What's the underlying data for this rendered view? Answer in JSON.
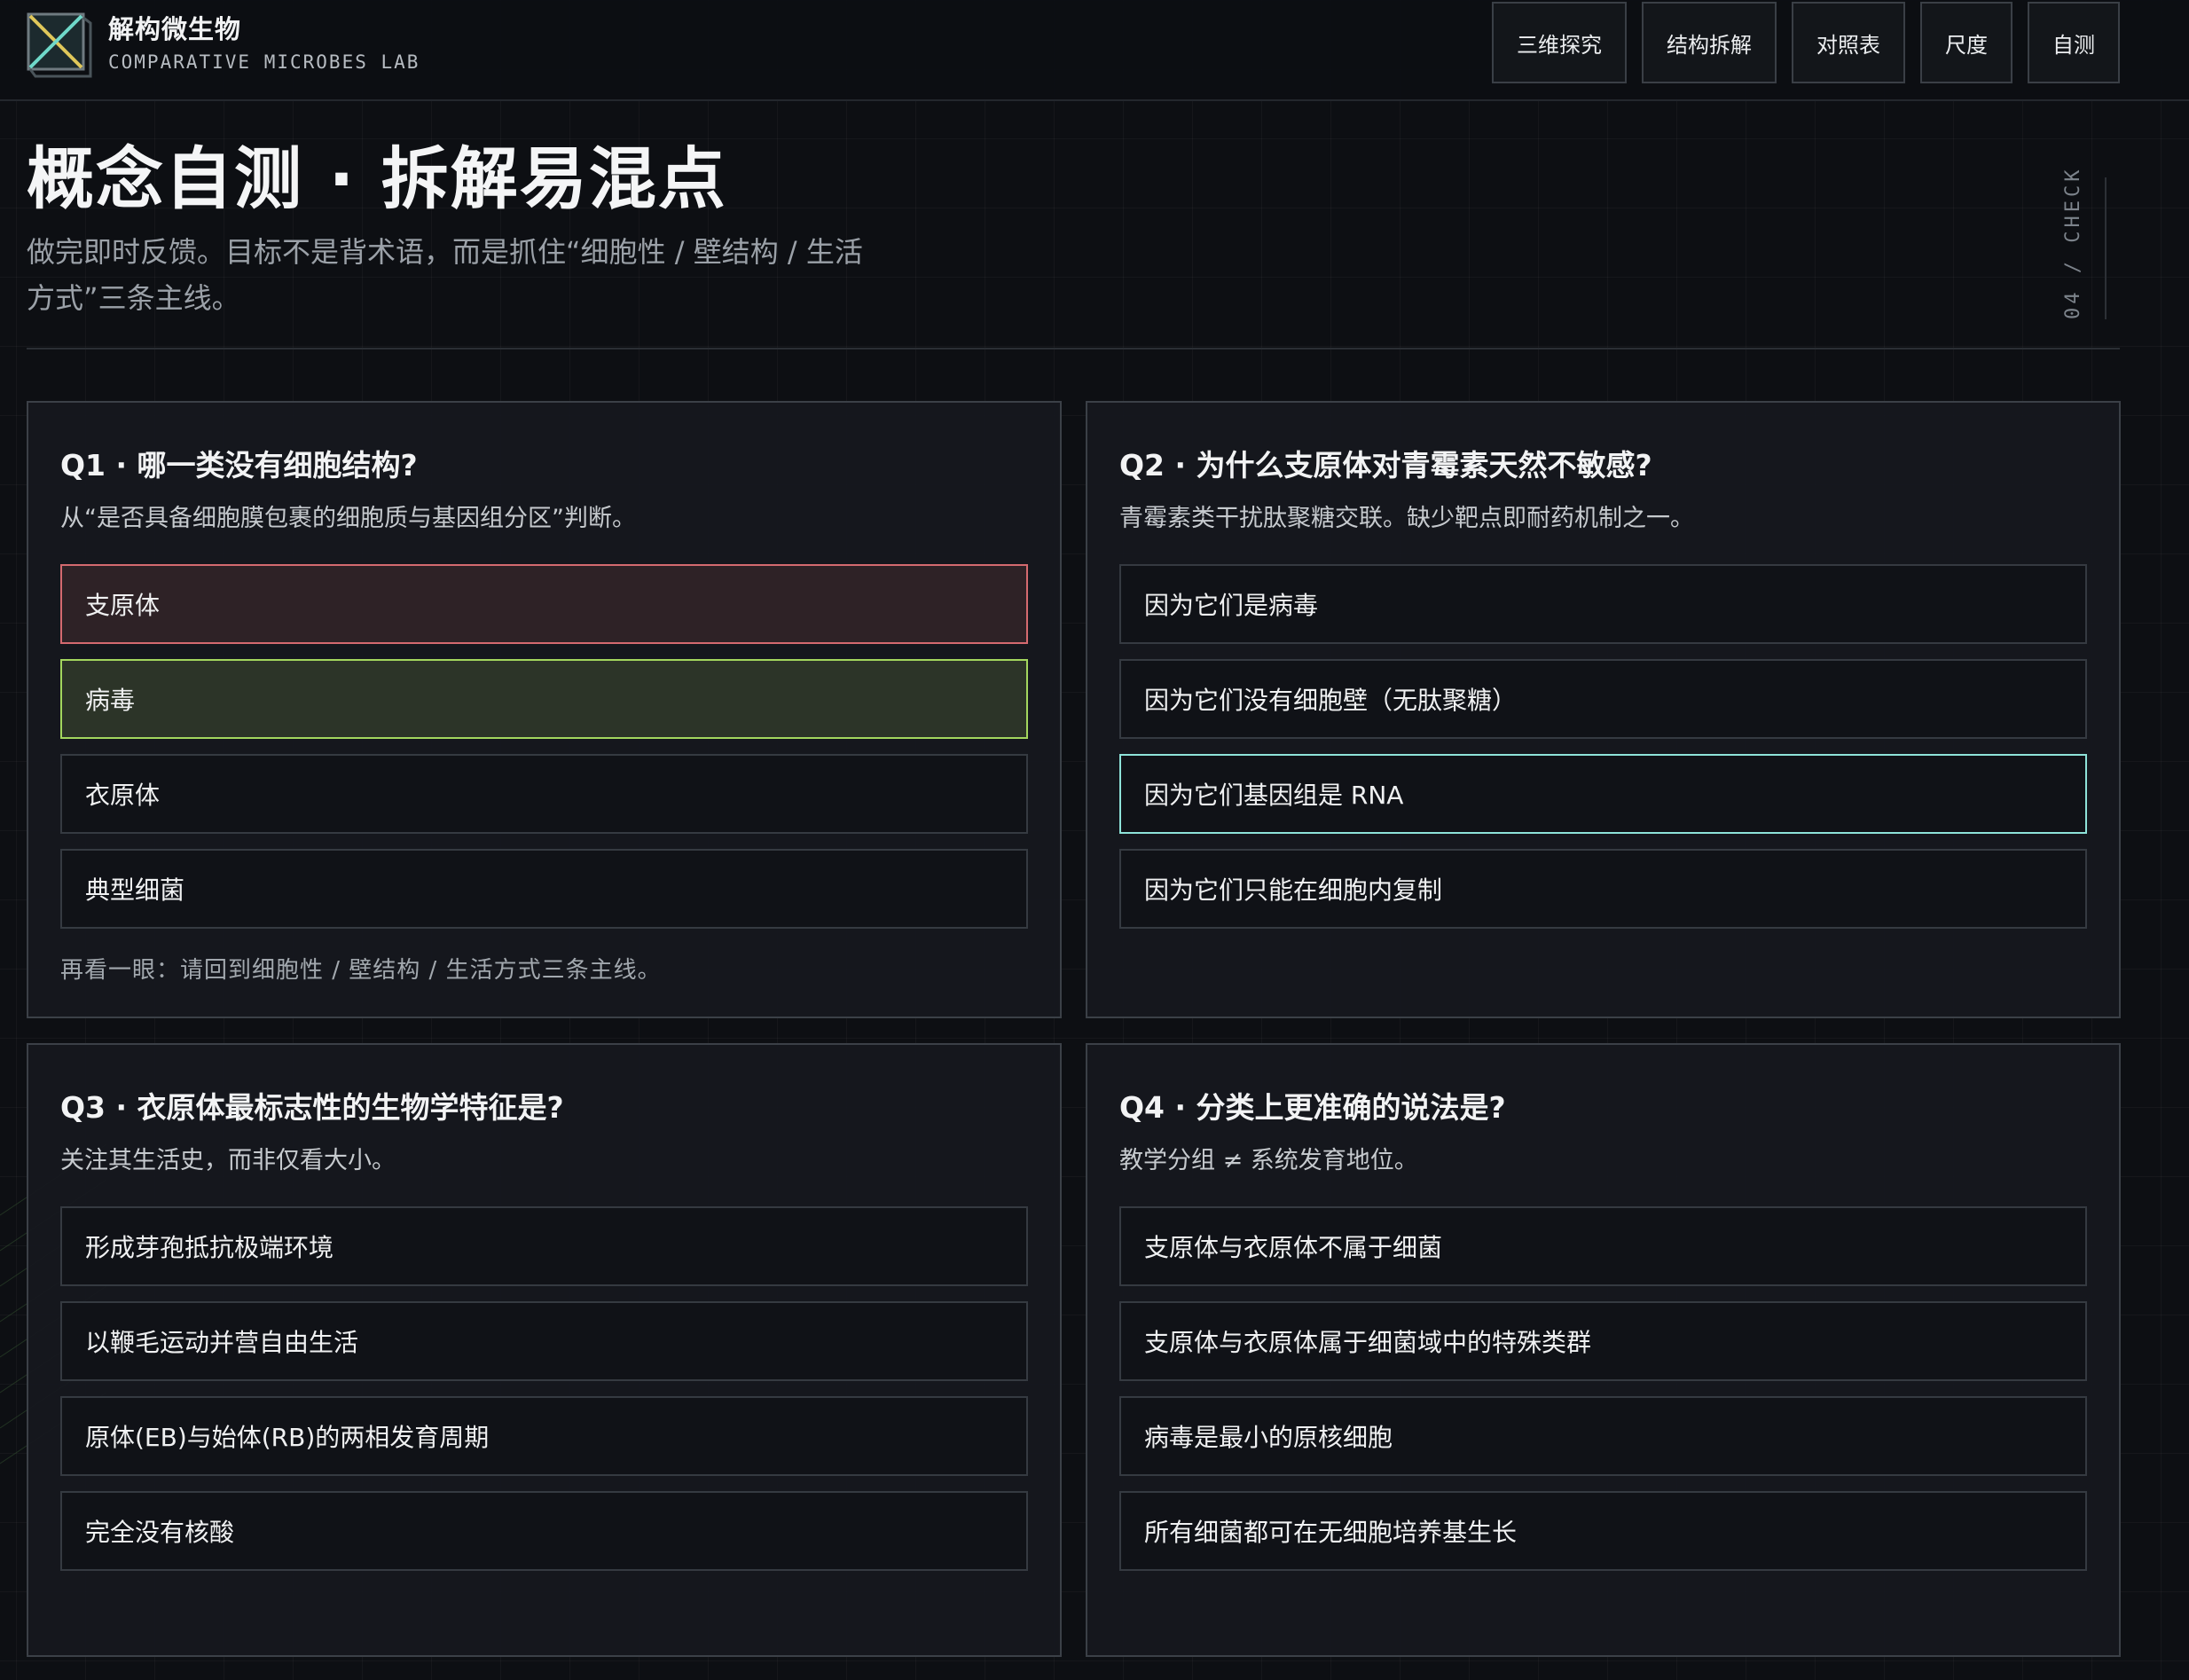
{
  "brand": {
    "title": "解构微生物",
    "subtitle": "COMPARATIVE MICROBES LAB"
  },
  "nav": [
    "三维探究",
    "结构拆解",
    "对照表",
    "尺度",
    "自测"
  ],
  "page": {
    "title": "概念自测 · 拆解易混点",
    "description": "做完即时反馈。目标不是背术语，而是抓住“细胞性 / 壁结构 / 生活方式”三条主线。",
    "side_tag": "04 / CHECK"
  },
  "colors": {
    "wrong": "#d46a6f",
    "correct": "#a3d65e",
    "selected": "#8ee3d9"
  },
  "questions": [
    {
      "q": "Q1 · 哪一类没有细胞结构?",
      "hint": "从“是否具备细胞膜包裹的细胞质与基因组分区”判断。",
      "options": [
        "支原体",
        "病毒",
        "衣原体",
        "典型细菌"
      ],
      "states": [
        "wrong",
        "correct",
        "",
        ""
      ],
      "feedback": "再看一眼：请回到细胞性 / 壁结构 / 生活方式三条主线。"
    },
    {
      "q": "Q2 · 为什么支原体对青霉素天然不敏感?",
      "hint": "青霉素类干扰肽聚糖交联。缺少靶点即耐药机制之一。",
      "options": [
        "因为它们是病毒",
        "因为它们没有细胞壁（无肽聚糖）",
        "因为它们基因组是 RNA",
        "因为它们只能在细胞内复制"
      ],
      "states": [
        "",
        "",
        "selected",
        ""
      ],
      "feedback": ""
    },
    {
      "q": "Q3 · 衣原体最标志性的生物学特征是?",
      "hint": "关注其生活史，而非仅看大小。",
      "options": [
        "形成芽孢抵抗极端环境",
        "以鞭毛运动并营自由生活",
        "原体(EB)与始体(RB)的两相发育周期",
        "完全没有核酸"
      ],
      "states": [
        "",
        "",
        "",
        ""
      ],
      "feedback": ""
    },
    {
      "q": "Q4 · 分类上更准确的说法是?",
      "hint": "教学分组 ≠ 系统发育地位。",
      "options": [
        "支原体与衣原体不属于细菌",
        "支原体与衣原体属于细菌域中的特殊类群",
        "病毒是最小的原核细胞",
        "所有细菌都可在无细胞培养基生长"
      ],
      "states": [
        "",
        "",
        "",
        ""
      ],
      "feedback": ""
    }
  ]
}
